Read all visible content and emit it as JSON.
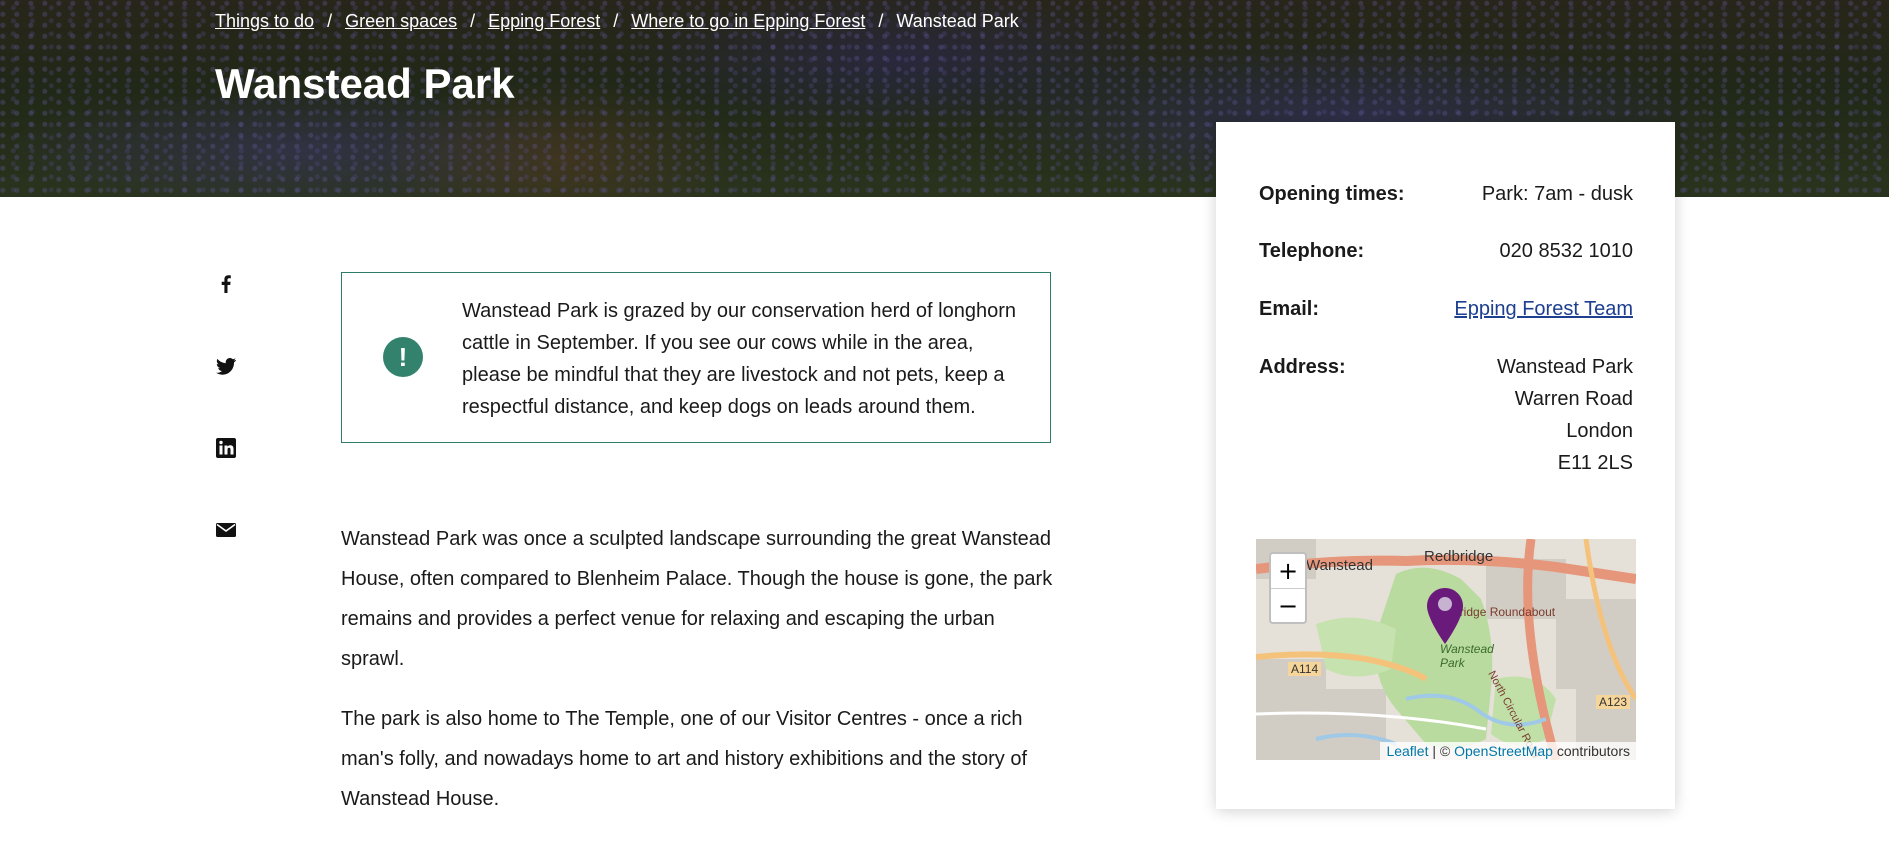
{
  "breadcrumb": {
    "items": [
      "Things to do",
      "Green spaces",
      "Epping Forest",
      "Where to go in Epping Forest"
    ],
    "current": "Wanstead Park",
    "separator": "/"
  },
  "page": {
    "title": "Wanstead Park"
  },
  "share": {
    "icons": [
      "facebook-icon",
      "twitter-icon",
      "linkedin-icon",
      "email-icon"
    ]
  },
  "notice": {
    "icon": "exclamation-icon",
    "icon_glyph": "!",
    "text": "Wanstead Park is grazed by our conservation herd of longhorn cattle in September. If you see our cows while in the area, please be mindful that they are livestock and not pets, keep a respectful distance, and keep dogs on leads around them.",
    "accent_color": "#32826e"
  },
  "body": {
    "paragraphs": [
      "Wanstead Park was once a sculpted landscape surrounding the great Wanstead House, often compared to Blenheim Palace. Though the house is gone, the park remains and provides a perfect venue for relaxing and escaping the urban sprawl.",
      "The park is also home to The Temple, one of our Visitor Centres - once a rich man's folly, and nowadays home to art and history exhibitions and the story of Wanstead House."
    ]
  },
  "info": {
    "opening_label": "Opening times:",
    "opening_value": "Park: 7am - dusk",
    "telephone_label": "Telephone:",
    "telephone_value": "020 8532 1010",
    "email_label": "Email:",
    "email_value": "Epping Forest Team",
    "address_label": "Address:",
    "address_lines": [
      "Wanstead Park",
      "Warren Road",
      "London",
      "E11 2LS"
    ],
    "link_color": "#1d3f8f"
  },
  "map": {
    "zoom_in": "+",
    "zoom_out": "−",
    "labels": {
      "wanstead": "Wanstead",
      "redbridge": "Redbridge",
      "roundabout": "Redbridge Roundabout",
      "park": "Wanstead Park",
      "a114": "A114",
      "a123": "A123",
      "road": "North Circular Road"
    },
    "attribution": {
      "leaflet": "Leaflet",
      "sep": " | © ",
      "osm": "OpenStreetMap",
      "contributors": " contributors"
    },
    "marker_color": "#6a1a7a"
  }
}
